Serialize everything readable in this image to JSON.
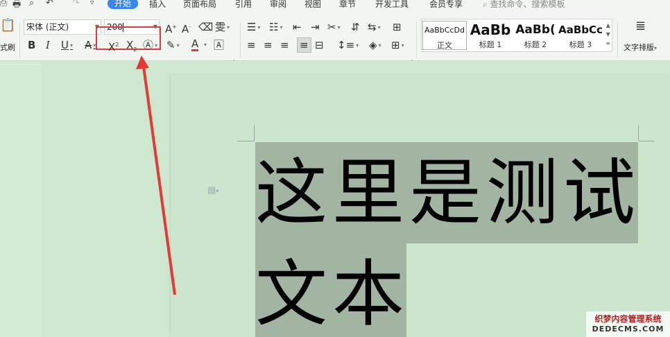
{
  "menu": {
    "tabs": [
      "开始",
      "插入",
      "页面布局",
      "引用",
      "审阅",
      "视图",
      "章节",
      "开发工具",
      "会员专享"
    ],
    "active_tab": "开始",
    "search_placeholder": "查找命令、搜索模板"
  },
  "ribbon": {
    "format_painter_label": "式刷",
    "font_name": "宋体 (正文)",
    "font_size": "200",
    "styles": [
      {
        "sample": "AaBbCcDd",
        "label": "正文"
      },
      {
        "sample": "AaBb",
        "label": "标题 1"
      },
      {
        "sample": "AaBb(",
        "label": "标题 2"
      },
      {
        "sample": "AaBbCc",
        "label": "标题 3"
      }
    ],
    "text_layout_label": "文字排版"
  },
  "document": {
    "lines": [
      "这里是测试",
      "文本"
    ]
  },
  "watermark": {
    "line1": "织梦内容管理系统",
    "line2": "DEDECMS.COM"
  },
  "colors": {
    "highlight_box": "#e53935",
    "arrow": "#e53935",
    "selection": "#a2b5a3",
    "active_tab": "#3b86e6"
  }
}
